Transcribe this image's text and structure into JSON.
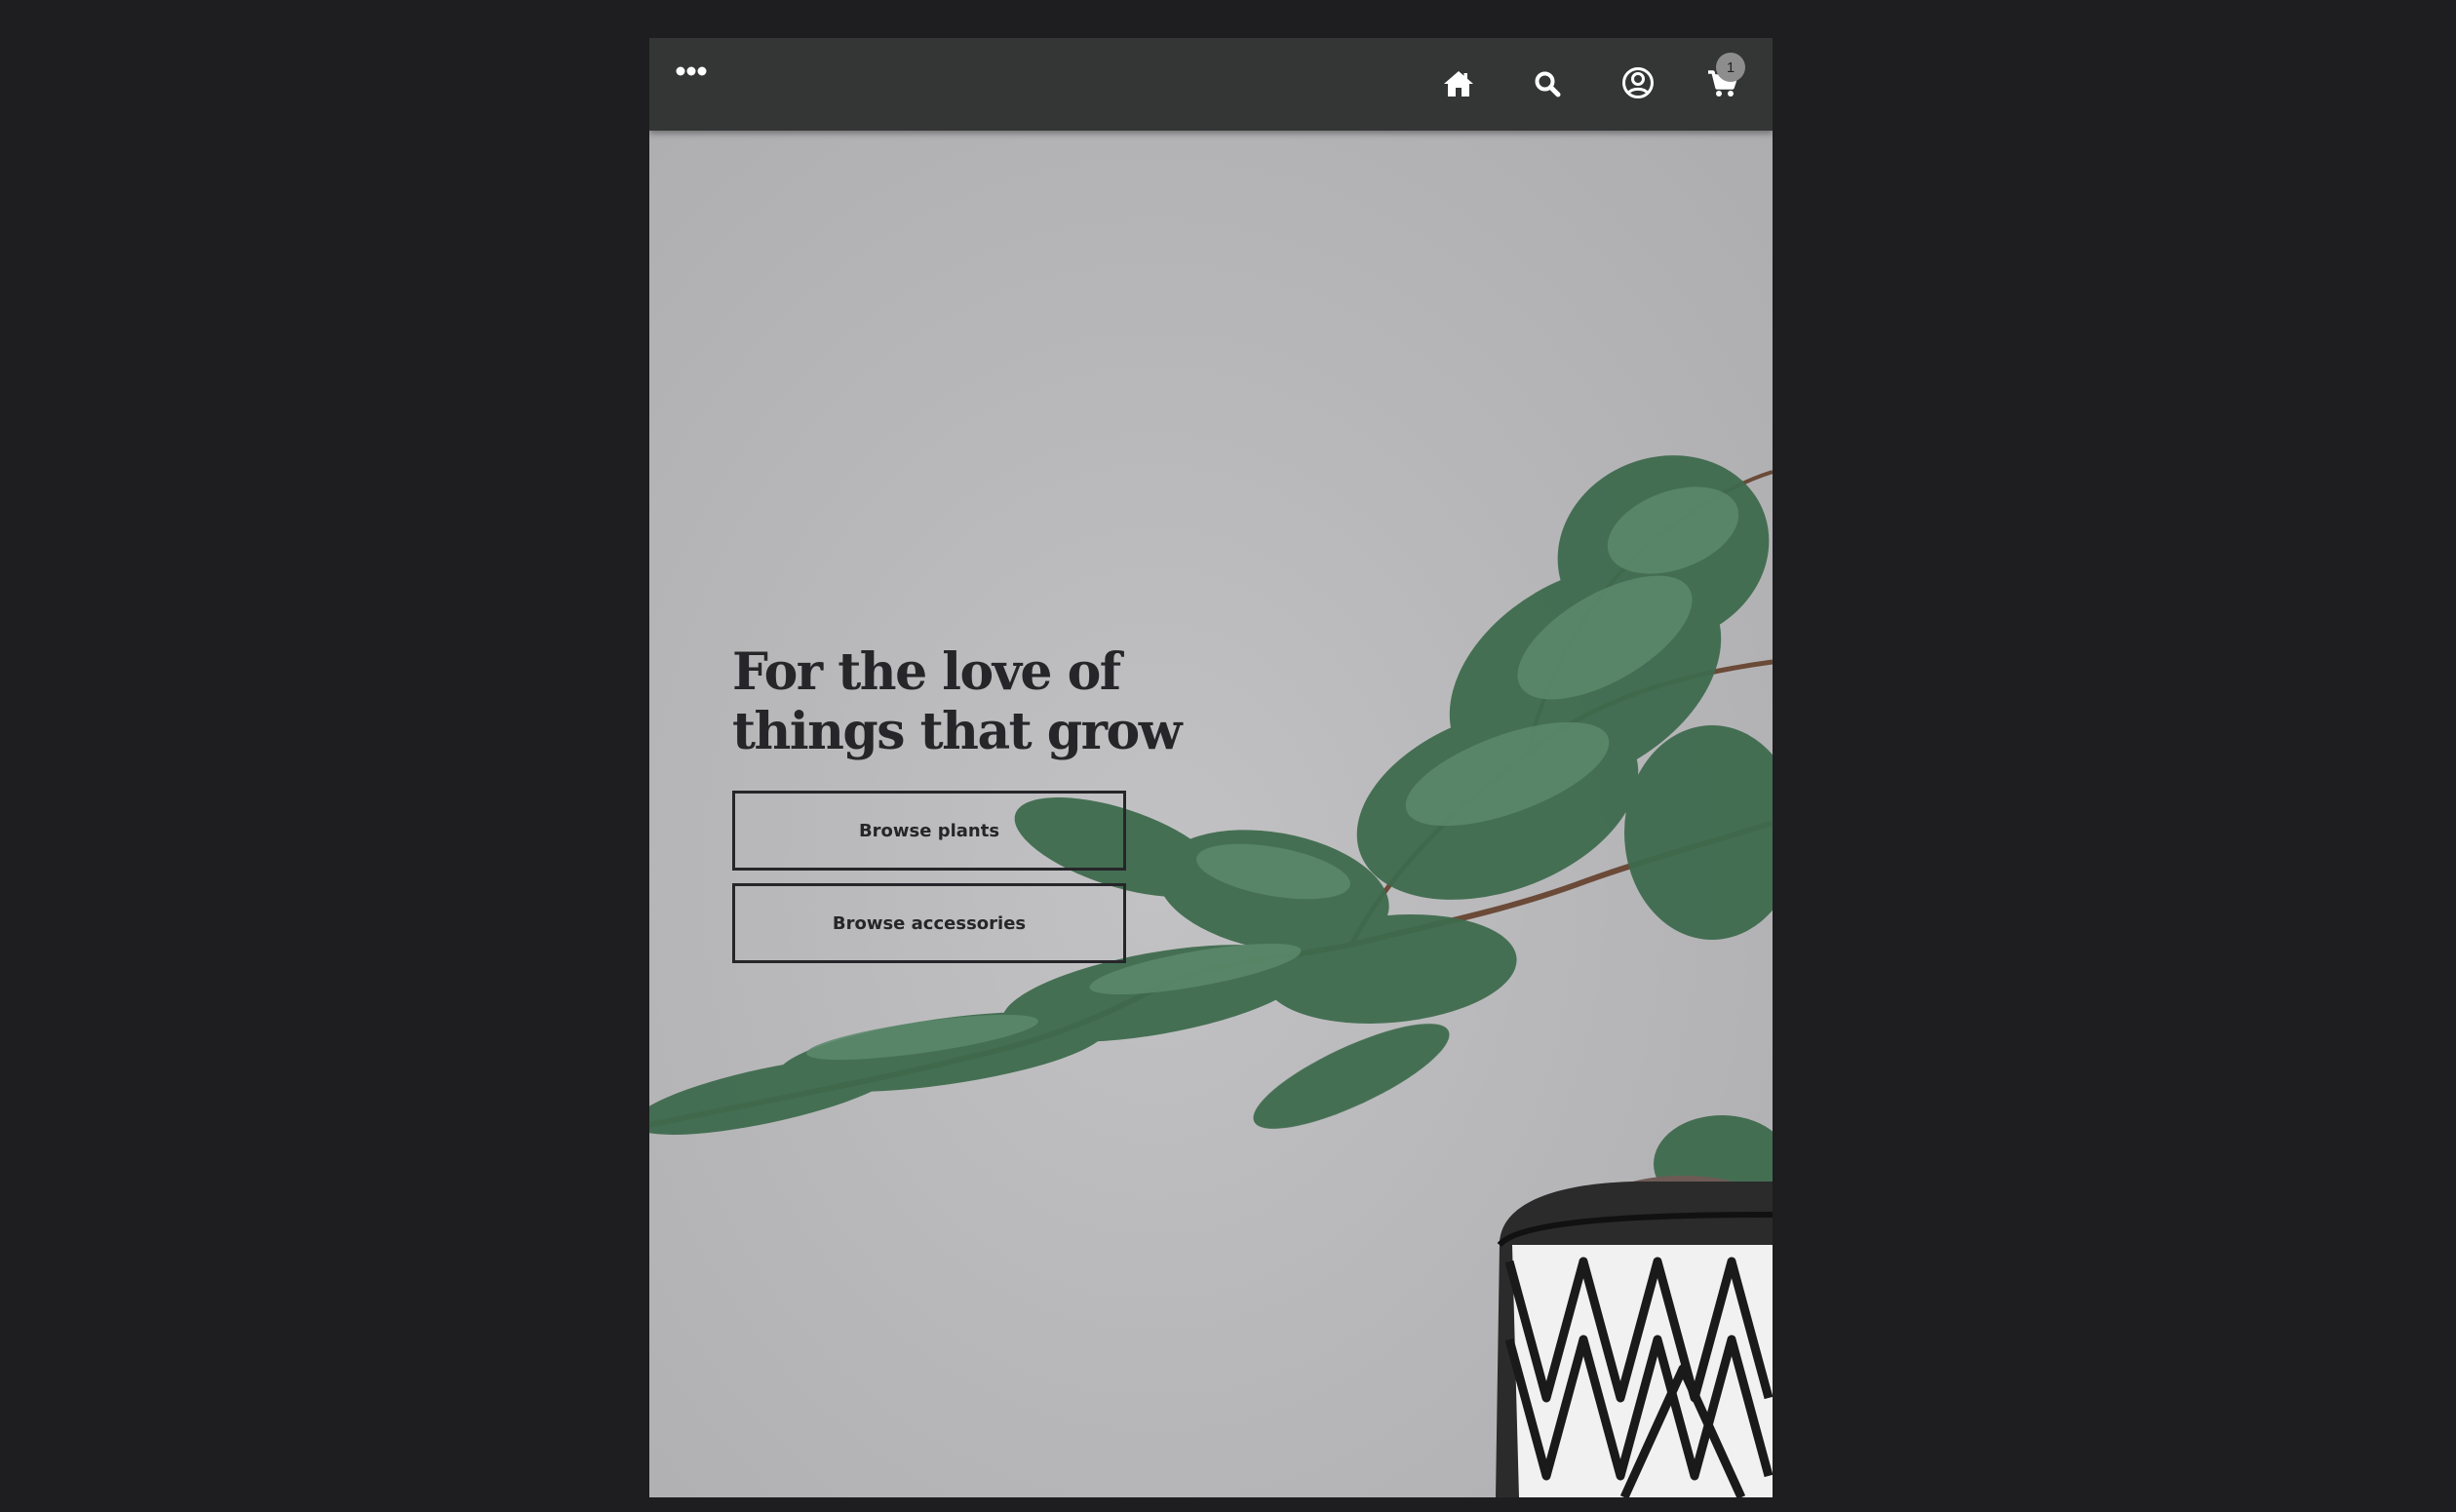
{
  "navbar": {
    "menu_icon": "more-horizontal-dots-icon",
    "home_icon": "home-icon",
    "search_icon": "search-icon",
    "account_icon": "user-circle-icon",
    "cart_icon": "shopping-cart-icon",
    "cart_count": "1"
  },
  "hero": {
    "title": "For the love of\nthings that grow",
    "browse_plants_label": "Browse plants",
    "browse_accessories_label": "Browse accessories",
    "image": "juniper-bonsai-in-black-and-white-patterned-pot"
  },
  "colors": {
    "page_background": "#1e1e20",
    "navbar": "#343535",
    "hero_background": "#b7b7b9",
    "text": "#26262a",
    "badge": "#8d8d8d",
    "foliage": "#3f6b4d"
  }
}
